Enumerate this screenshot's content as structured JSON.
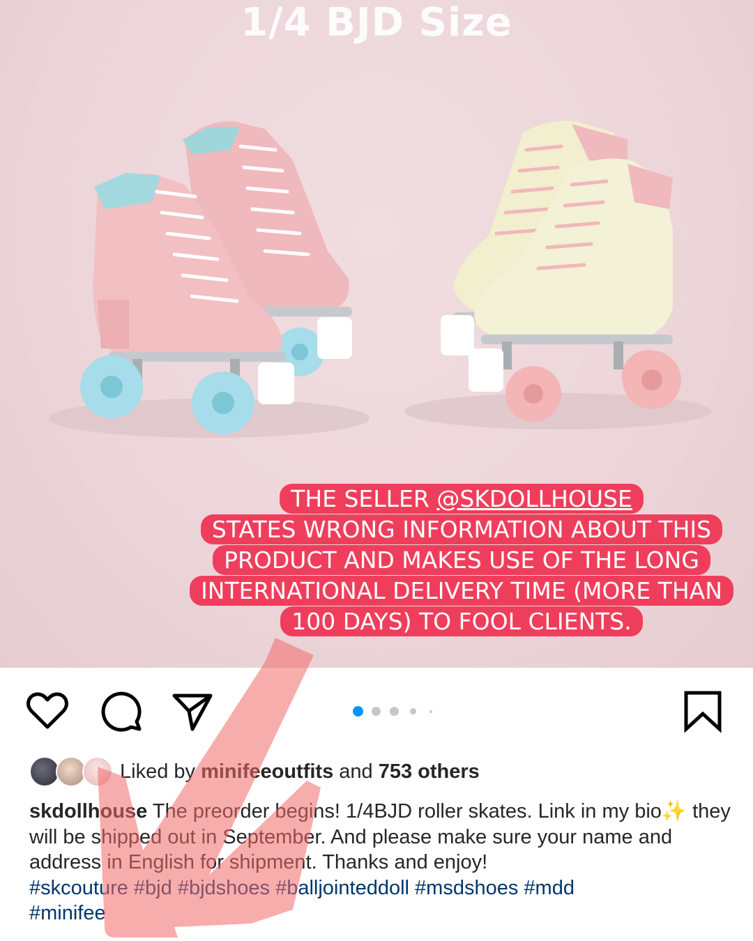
{
  "photo": {
    "title": "1/4 BJD Size",
    "overlay_lines": [
      {
        "prefix": "THE SELLER ",
        "mention": "@SKDOLLHOUSE"
      },
      {
        "text": "STATES WRONG INFORMATION ABOUT THIS"
      },
      {
        "text": "PRODUCT AND MAKES USE OF THE LONG"
      },
      {
        "text": "INTERNATIONAL DELIVERY TIME (MORE THAN"
      },
      {
        "text": "100 DAYS) TO FOOL CLIENTS."
      }
    ],
    "overlay_color": "#ef3e5c"
  },
  "actions": {
    "icons": [
      "heart-icon",
      "comment-icon",
      "share-icon",
      "bookmark-icon"
    ],
    "carousel": {
      "count": 5,
      "active_index": 0,
      "active_color": "#0095f6"
    }
  },
  "likes": {
    "prefix": "Liked by ",
    "user": "minifeeoutfits",
    "middle": " and ",
    "others": "753 others"
  },
  "caption": {
    "username": "skdollhouse",
    "text_1": " The preorder begins! 1/4BJD roller skates. Link in my bio",
    "sparkle": "✨",
    "text_2": " they will be shipped out in September. And please make sure your name and address in English for shipment. Thanks and enjoy!",
    "hashtags": [
      "#skcouture",
      "#bjd",
      "#bjdshoes",
      "#balljointeddoll",
      "#msdshoes",
      "#mdd",
      "#minifee"
    ]
  },
  "annotation": {
    "arrow_color": "#f36a6a"
  }
}
